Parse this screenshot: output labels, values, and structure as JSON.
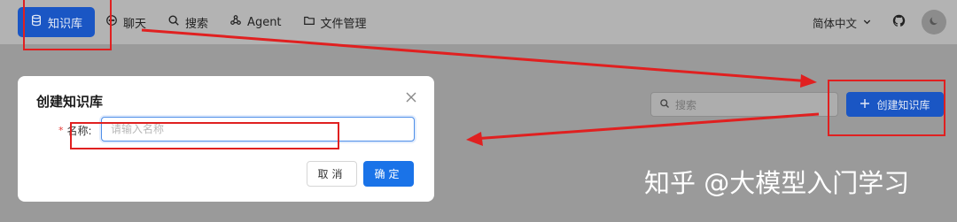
{
  "nav": {
    "items": [
      {
        "label": "知识库",
        "icon": "database-icon",
        "active": true
      },
      {
        "label": "聊天",
        "icon": "chat-bubble-icon",
        "active": false
      },
      {
        "label": "搜索",
        "icon": "search-icon",
        "active": false
      },
      {
        "label": "Agent",
        "icon": "agent-nodes-icon",
        "active": false
      },
      {
        "label": "文件管理",
        "icon": "folder-icon",
        "active": false
      }
    ],
    "language": "简体中文",
    "language_icon": "chevron-down-icon",
    "github_icon": "github-icon",
    "theme_icon": "moon-icon"
  },
  "toolbar": {
    "search_placeholder": "搜索",
    "create_label": "创建知识库"
  },
  "dialog": {
    "title": "创建知识库",
    "name_label": "名称:",
    "name_required_mark": "*",
    "name_placeholder": "请输入名称",
    "name_value": "",
    "cancel_label": "取消",
    "ok_label": "确定"
  },
  "watermark": "知乎 @大模型入门学习",
  "colors": {
    "accent": "#1a73e8",
    "annotation": "#e02020",
    "overlay": "#9a9a9a"
  }
}
